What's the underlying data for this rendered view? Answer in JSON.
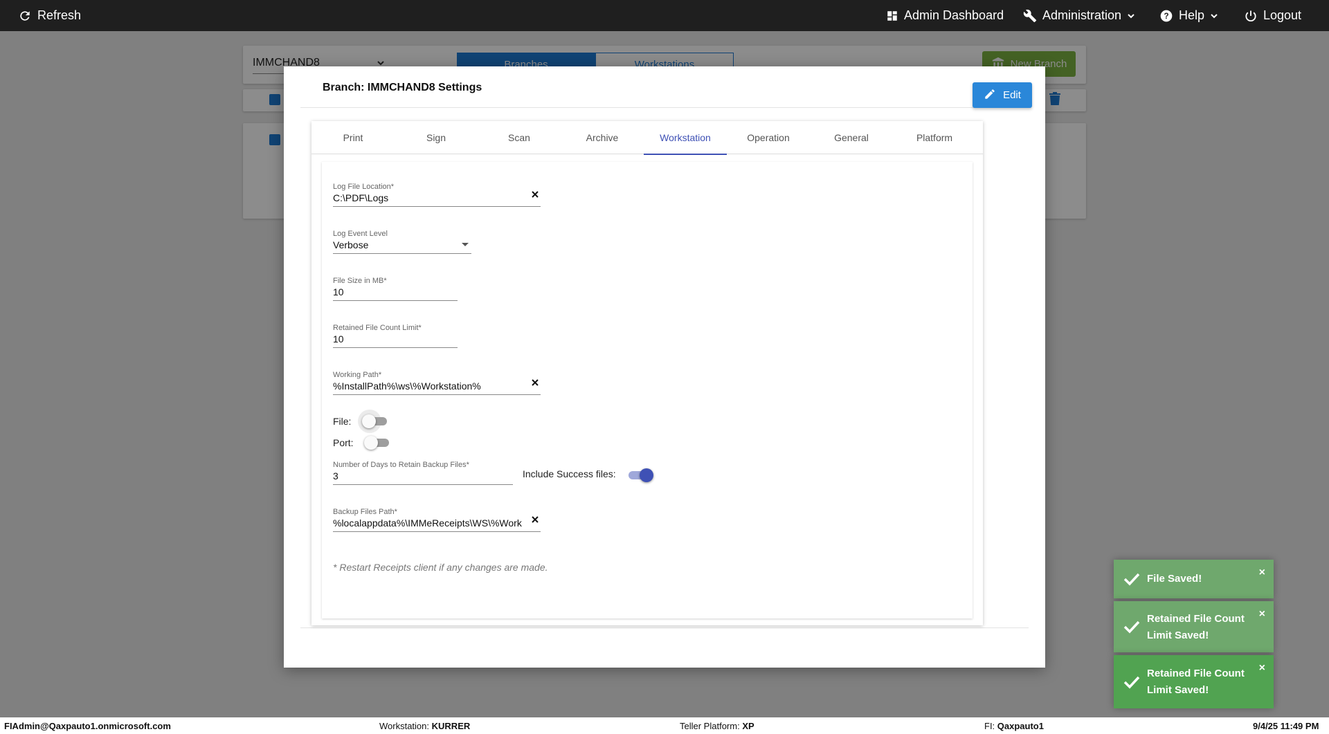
{
  "topbar": {
    "refresh_label": "Refresh",
    "admin_dashboard_label": "Admin Dashboard",
    "administration_label": "Administration",
    "help_label": "Help",
    "logout_label": "Logout"
  },
  "background": {
    "branch_select_value": "IMMCHAND8",
    "tabs": [
      "Branches",
      "Workstations"
    ],
    "new_branch_label": "New Branch"
  },
  "modal": {
    "title": "Branch: IMMCHAND8 Settings",
    "edit_label": "Edit",
    "tabs": [
      "Print",
      "Sign",
      "Scan",
      "Archive",
      "Workstation",
      "Operation",
      "General",
      "Platform"
    ],
    "active_tab": "Workstation",
    "fields": {
      "log_file_location": {
        "label": "Log File Location*",
        "value": "C:\\PDF\\Logs"
      },
      "log_event_level": {
        "label": "Log Event Level",
        "value": "Verbose"
      },
      "file_size_mb": {
        "label": "File Size in MB*",
        "value": "10"
      },
      "retained_file_count": {
        "label": "Retained File Count Limit*",
        "value": "10"
      },
      "working_path": {
        "label": "Working Path*",
        "value": "%InstallPath%\\ws\\%Workstation%"
      },
      "file_toggle": {
        "label": "File:",
        "checked": false
      },
      "port_toggle": {
        "label": "Port:",
        "checked": false
      },
      "days_retain_backup": {
        "label": "Number of Days to Retain Backup Files*",
        "value": "3"
      },
      "include_success": {
        "label": "Include Success files:",
        "checked": true
      },
      "backup_files_path": {
        "label": "Backup Files Path*",
        "value": "%localappdata%\\IMMeReceipts\\WS\\%Work"
      }
    },
    "note": "* Restart Receipts client if any changes are made."
  },
  "toasts": [
    {
      "message": "File Saved!",
      "close": "×"
    },
    {
      "message": "Retained File Count Limit Saved!",
      "close": "×"
    },
    {
      "message": "Retained File Count Limit Saved!",
      "close": "×"
    }
  ],
  "footer": {
    "user": "FIAdmin@Qaxpauto1.onmicrosoft.com",
    "workstation_label": "Workstation:",
    "workstation_value": "KURRER",
    "teller_platform_label": "Teller Platform:",
    "teller_platform_value": "XP",
    "fi_label": "FI:",
    "fi_value": "Qaxpauto1",
    "datetime": "9/4/25 11:49 PM"
  },
  "colors": {
    "topbar": "#1f1f1f",
    "primary_blue": "#2a87d9",
    "active_tab": "#3f51b5",
    "toast_success": "#51a351",
    "new_branch_green": "#7cb342"
  }
}
